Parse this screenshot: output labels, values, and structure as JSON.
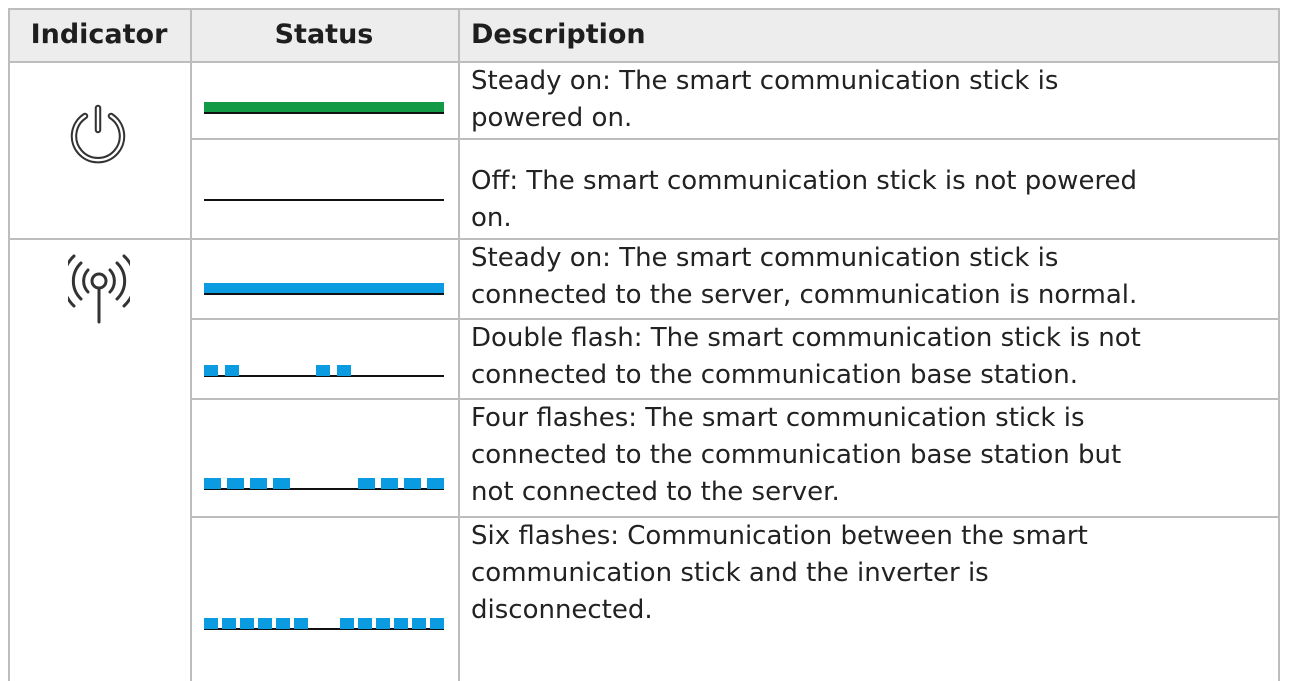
{
  "table": {
    "headers": {
      "indicator": "Indicator",
      "status": "Status",
      "description": "Description"
    },
    "groups": [
      {
        "indicator_icon": "power-icon",
        "rows": [
          {
            "status_pattern": "steady-green",
            "description_lines": [
              "Steady on: The smart communication stick is",
              "powered on."
            ]
          },
          {
            "status_pattern": "off",
            "description_lines": [
              "Off: The smart communication stick is not powered",
              "on."
            ]
          }
        ]
      },
      {
        "indicator_icon": "wireless-signal-icon",
        "rows": [
          {
            "status_pattern": "steady-blue",
            "description_lines": [
              "Steady on: The smart communication stick is",
              "connected to the server, communication is normal."
            ]
          },
          {
            "status_pattern": "double-flash-blue",
            "description_lines": [
              "Double flash: The smart communication stick is not",
              "connected to the communication base station."
            ]
          },
          {
            "status_pattern": "four-flashes-blue",
            "description_lines": [
              "Four flashes: The smart communication stick is",
              "connected to the communication base station but",
              "not connected to the server."
            ]
          },
          {
            "status_pattern": "six-flashes-blue",
            "description_lines": [
              "Six flashes: Communication between the smart",
              "communication stick and the inverter is",
              "disconnected."
            ]
          }
        ]
      }
    ]
  },
  "colors": {
    "green": "#129a47",
    "blue": "#0b9be0",
    "border": "#bdbdbd",
    "header_bg": "#ededed"
  }
}
